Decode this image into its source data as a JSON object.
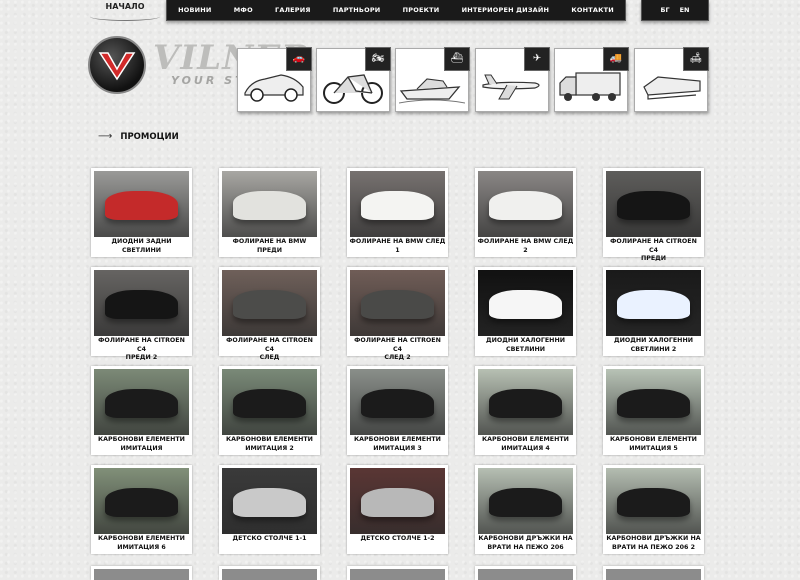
{
  "nav": {
    "home": "НАЧАЛО",
    "items": [
      "НОВИНИ",
      "МФО",
      "ГАЛЕРИЯ",
      "ПАРТНЬОРИ",
      "ПРОЕКТИ",
      "ИНТЕРИОРЕН ДИЗАЙН",
      "КОНТАКТИ"
    ],
    "languages": [
      "БГ",
      "EN"
    ]
  },
  "brand": {
    "name": "VILNER",
    "tagline": "YOUR ST"
  },
  "categories": [
    {
      "name": "car",
      "icon": "car-icon"
    },
    {
      "name": "motorcycle",
      "icon": "motorcycle-icon"
    },
    {
      "name": "boat",
      "icon": "boat-icon"
    },
    {
      "name": "airplane",
      "icon": "airplane-icon"
    },
    {
      "name": "truck",
      "icon": "truck-icon"
    },
    {
      "name": "interior",
      "icon": "interior-icon"
    }
  ],
  "section_title": "ПРОМОЦИИ",
  "promotions": [
    {
      "line1": "ДИОДНИ ЗАДНИ СВЕТЛИНИ",
      "line2": "",
      "bg": "#9a9a98",
      "accent": "#c42a2a"
    },
    {
      "line1": "ФОЛИРАНЕ НА BMW ПРЕДИ",
      "line2": "",
      "bg": "#a8a7a3",
      "accent": "#e2e2de"
    },
    {
      "line1": "ФОЛИРАНЕ НА BMW СЛЕД 1",
      "line2": "",
      "bg": "#777270",
      "accent": "#f4f4f2"
    },
    {
      "line1": "ФОЛИРАНЕ НА BMW СЛЕД 2",
      "line2": "",
      "bg": "#8a8785",
      "accent": "#f0f0ee"
    },
    {
      "line1": "ФОЛИРАНЕ НА CITROEN C4",
      "line2": "ПРЕДИ",
      "bg": "#5e5d5b",
      "accent": "#151515"
    },
    {
      "line1": "ФОЛИРАНЕ НА CITROEN C4",
      "line2": "ПРЕДИ 2",
      "bg": "#666462",
      "accent": "#151515"
    },
    {
      "line1": "ФОЛИРАНЕ НА CITROEN C4",
      "line2": "СЛЕД",
      "bg": "#6f605a",
      "accent": "#4c4c4a"
    },
    {
      "line1": "ФОЛИРАНЕ НА CITROEN C4",
      "line2": "СЛЕД 2",
      "bg": "#705d57",
      "accent": "#4a4a48"
    },
    {
      "line1": "ДИОДНИ ХАЛОГЕННИ",
      "line2": "СВЕТЛИНИ",
      "bg": "#111111",
      "accent": "#f6f6f6"
    },
    {
      "line1": "ДИОДНИ ХАЛОГЕННИ",
      "line2": "СВЕТЛИНИ 2",
      "bg": "#1a1a1a",
      "accent": "#eaf2ff"
    },
    {
      "line1": "КАРБОНОВИ ЕЛЕМЕНТИ",
      "line2": "ИМИТАЦИЯ",
      "bg": "#7c8a77",
      "accent": "#1b1b1b"
    },
    {
      "line1": "КАРБОНОВИ ЕЛЕМЕНТИ",
      "line2": "ИМИТАЦИЯ 2",
      "bg": "#7a8a78",
      "accent": "#1b1b1b"
    },
    {
      "line1": "КАРБОНОВИ ЕЛЕМЕНТИ",
      "line2": "ИМИТАЦИЯ 3",
      "bg": "#8a8f8a",
      "accent": "#1b1b1b"
    },
    {
      "line1": "КАРБОНОВИ ЕЛЕМЕНТИ",
      "line2": "ИМИТАЦИЯ 4",
      "bg": "#b7c0b3",
      "accent": "#1b1b1b"
    },
    {
      "line1": "КАРБОНОВИ ЕЛЕМЕНТИ",
      "line2": "ИМИТАЦИЯ 5",
      "bg": "#b8c3b6",
      "accent": "#1b1b1b"
    },
    {
      "line1": "КАРБОНОВИ ЕЛЕМЕНТИ",
      "line2": "ИМИТАЦИЯ 6",
      "bg": "#819079",
      "accent": "#1b1b1b"
    },
    {
      "line1": "ДЕТСКО СТОЛЧЕ 1-1",
      "line2": "",
      "bg": "#3a3a3a",
      "accent": "#c9c9c9"
    },
    {
      "line1": "ДЕТСКО СТОЛЧЕ 1-2",
      "line2": "",
      "bg": "#5a3634",
      "accent": "#b8b8b8"
    },
    {
      "line1": "КАРБОНОВИ ДРЪЖКИ НА",
      "line2": "ВРАТИ НА ПЕЖО 206",
      "bg": "#b6bfb3",
      "accent": "#1b1b1b"
    },
    {
      "line1": "КАРБОНОВИ ДРЪЖКИ НА",
      "line2": "ВРАТИ НА ПЕЖО 206 2",
      "bg": "#b4bdb1",
      "accent": "#1b1b1b"
    }
  ]
}
